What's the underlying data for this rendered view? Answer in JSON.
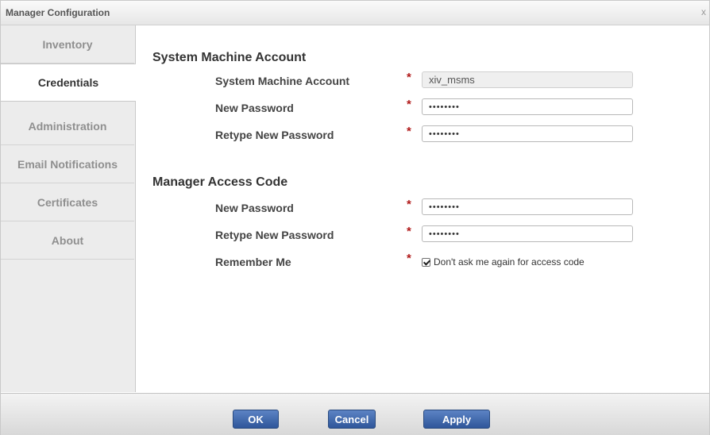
{
  "window": {
    "title": "Manager Configuration",
    "close_label": "x"
  },
  "sidebar": {
    "items": [
      {
        "label": "Inventory"
      },
      {
        "label": "Credentials"
      },
      {
        "label": "Administration"
      },
      {
        "label": "Email Notifications"
      },
      {
        "label": "Certificates"
      },
      {
        "label": "About"
      }
    ],
    "active": "Credentials"
  },
  "system_machine_account": {
    "title": "System Machine Account",
    "fields": [
      {
        "label": "System Machine Account",
        "value": "xiv_msms",
        "required": "*"
      },
      {
        "label": "New Password",
        "value": "••••••••",
        "required": "*"
      },
      {
        "label": "Retype New Password",
        "value": "••••••••",
        "required": "*"
      }
    ]
  },
  "manager_access_code": {
    "title": "Manager Access Code",
    "fields": [
      {
        "label": "New Password",
        "value": "••••••••",
        "required": "*"
      },
      {
        "label": "Retype New Password",
        "value": "••••••••",
        "required": "*"
      }
    ],
    "remember": {
      "label": "Remember Me",
      "required": "*",
      "checkbox_label": "Don't ask me again for access code",
      "checked": true
    }
  },
  "footer": {
    "ok": "OK",
    "cancel": "Cancel",
    "apply": "Apply"
  },
  "colors": {
    "button": "#3a62a6",
    "required": "#b01818"
  }
}
